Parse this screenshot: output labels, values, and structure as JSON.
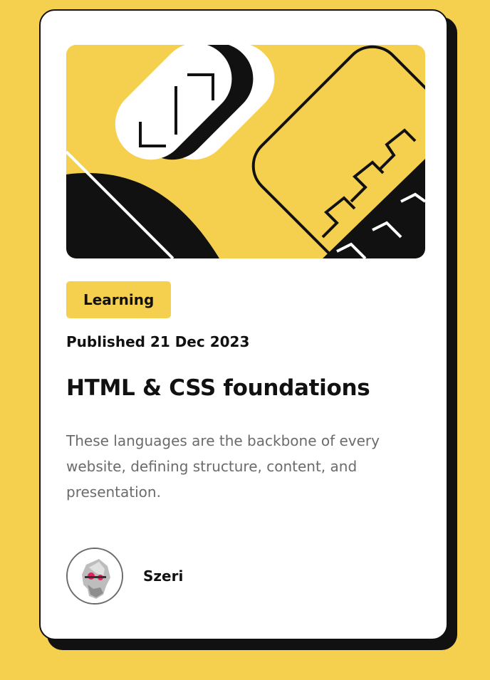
{
  "card": {
    "tag_label": "Learning",
    "published": "Published 21 Dec 2023",
    "title": "HTML & CSS foundations",
    "description": "These languages are the backbone of every website, defining structure, content, and presentation.",
    "author": {
      "name": "Szeri",
      "avatar_icon": "skull-avatar-icon"
    },
    "hero_icon": "abstract-geometric-illustration"
  },
  "colors": {
    "background": "#F4D04E",
    "card": "#FFFFFF",
    "ink": "#111111",
    "muted_text": "#6B6B6B",
    "accent": "#F4D04E"
  }
}
